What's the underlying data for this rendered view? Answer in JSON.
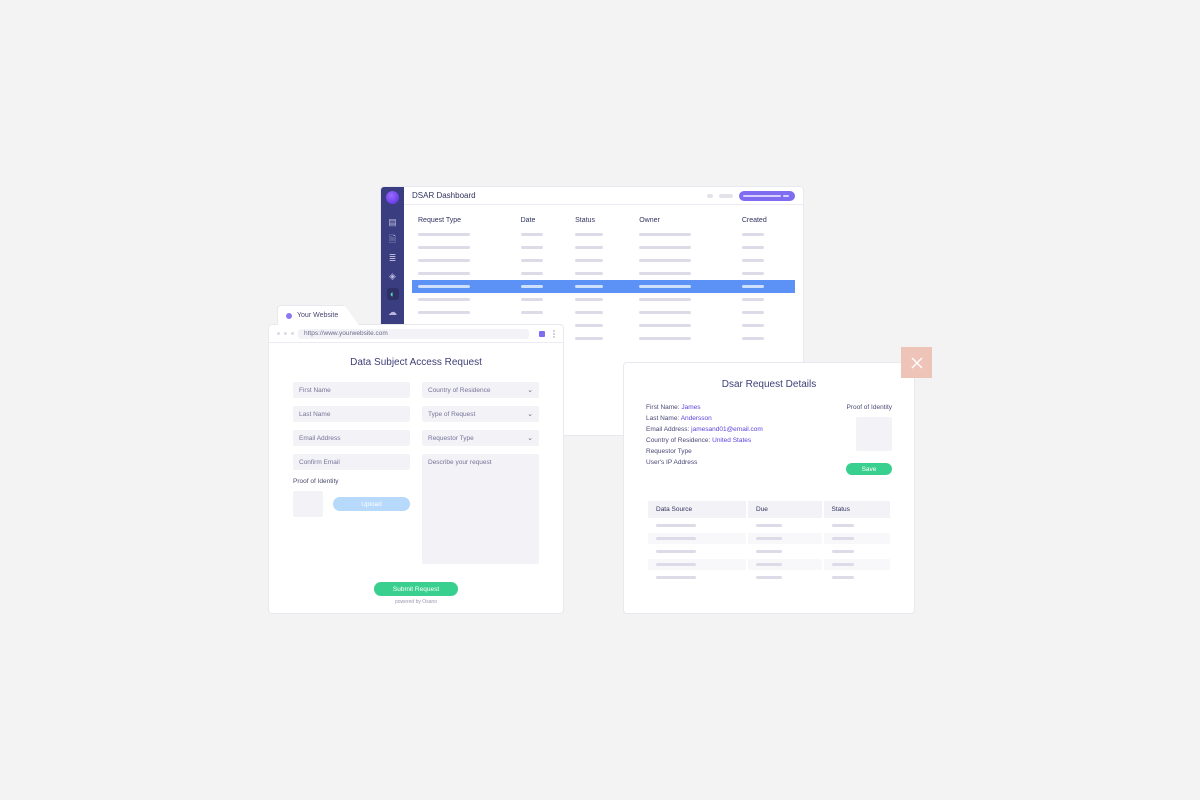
{
  "dashboard": {
    "title": "DSAR Dashboard",
    "columns": [
      "Request Type",
      "Date",
      "Status",
      "Owner",
      "Created"
    ],
    "row_count": 9,
    "selected_row_index": 4,
    "sidebar_icons": [
      "layers",
      "clipboard",
      "list",
      "diamond",
      "shield",
      "cloud",
      "sliders"
    ]
  },
  "browser": {
    "tab_label": "Your Website",
    "url": "https://www.yourwebsite.com"
  },
  "form": {
    "title": "Data Subject Access Request",
    "fields": {
      "first_name": "First Name",
      "last_name": "Last Name",
      "email": "Email Address",
      "confirm_email": "Confirm Email",
      "country": "Country of Residence",
      "request_type": "Type of Request",
      "requestor_type": "Requestor Type",
      "describe": "Describe your request"
    },
    "proof_label": "Proof of Identity",
    "upload_label": "Upload",
    "submit_label": "Submit Request",
    "powered_by": "powered by Osano"
  },
  "details": {
    "title": "Dsar Request Details",
    "fields": [
      {
        "label": "First Name",
        "value": "James"
      },
      {
        "label": "Last Name",
        "value": "Andersson"
      },
      {
        "label": "Email Address",
        "value": "jamesand01@email.com"
      },
      {
        "label": "Country of Residence",
        "value": "United States"
      },
      {
        "label": "Requestor Type",
        "value": ""
      },
      {
        "label": "User's IP Address",
        "value": ""
      }
    ],
    "proof_label": "Proof of Identity",
    "save_label": "Save",
    "table_columns": [
      "Data Source",
      "Due",
      "Status"
    ],
    "table_row_count": 5
  }
}
